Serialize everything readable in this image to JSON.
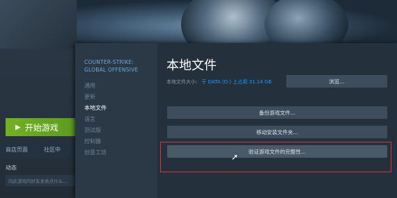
{
  "game": {
    "title": "COUNTER-STRIKE: GLOBAL OFFENSIVE"
  },
  "left_panel": {
    "play_label": "开始游戏",
    "tabs": [
      "商店页面",
      "社区中"
    ],
    "activity_title": "动态",
    "activity_placeholder": "向此游戏的好友发表点什么..."
  },
  "sidebar": {
    "items": [
      {
        "label": "通用",
        "active": false
      },
      {
        "label": "更新",
        "active": false
      },
      {
        "label": "本地文件",
        "active": true
      },
      {
        "label": "语言",
        "active": false
      },
      {
        "label": "测试版",
        "active": false
      },
      {
        "label": "控制器",
        "active": false
      },
      {
        "label": "创意工坊",
        "active": false
      }
    ]
  },
  "main": {
    "title": "本地文件",
    "size_label": "本地文件大小:",
    "size_value": "于 DATA (D:) 上占用 31.14 GB",
    "browse_label": "浏览...",
    "backup_label": "备份游戏文件...",
    "move_label": "移动安装文件夹...",
    "verify_label": "验证游戏文件的完整性..."
  },
  "colors": {
    "accent": "#1a9fff",
    "play": "#75b022",
    "highlight": "#e0322c"
  }
}
